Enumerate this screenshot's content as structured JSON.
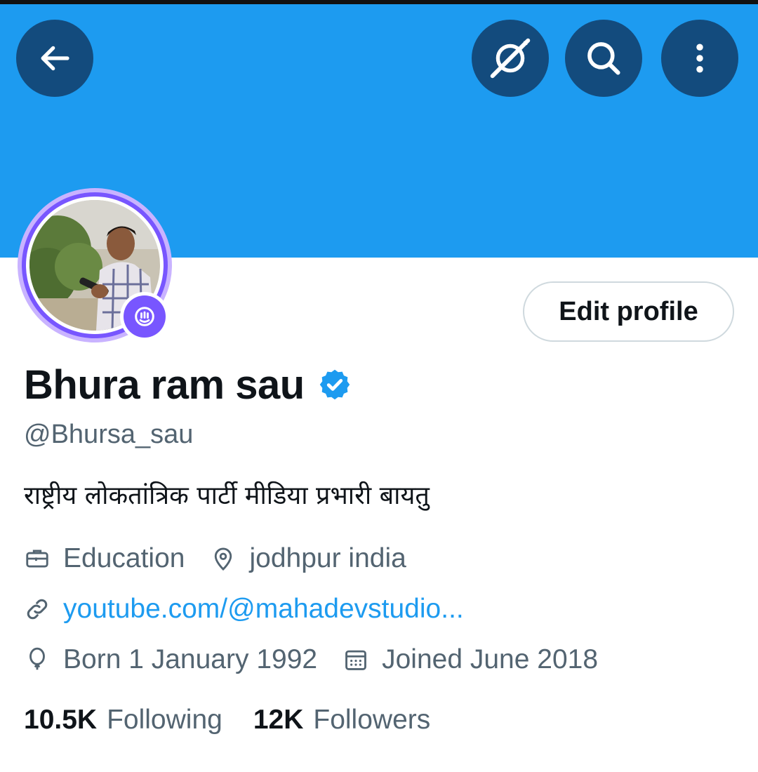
{
  "header": {
    "banner_color": "#1d9bf0",
    "buttons": {
      "back": "back-arrow-icon",
      "grok": "grok-icon",
      "search": "search-icon",
      "more": "more-vertical-icon"
    }
  },
  "profile": {
    "edit_label": "Edit profile",
    "name": "Bhura ram sau",
    "handle": "@Bhursa_sau",
    "bio": "राष्ट्रीय लोकतांत्रिक पार्टी मीडिया प्रभारी बायतु",
    "verified": true,
    "spaces_live": true,
    "category": "Education",
    "location": "jodhpur india",
    "website": "youtube.com/@mahadevstudio...",
    "birthday": "Born 1 January 1992",
    "joined": "Joined June 2018"
  },
  "stats": {
    "following_count": "10.5K",
    "following_label": "Following",
    "followers_count": "12K",
    "followers_label": "Followers"
  },
  "colors": {
    "accent": "#1d9bf0",
    "spaces": "#7856ff",
    "secondary_text": "#536471"
  }
}
